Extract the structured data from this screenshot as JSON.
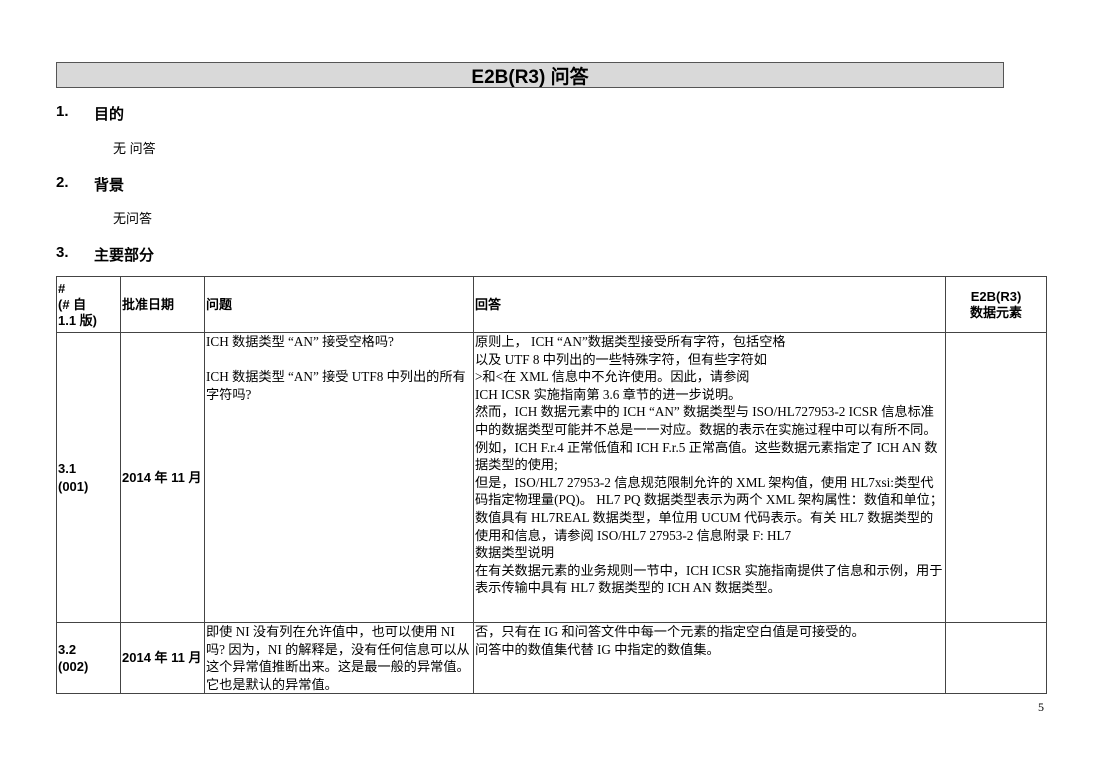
{
  "document": {
    "title": "E2B(R3) 问答",
    "page_number": "5"
  },
  "sections": [
    {
      "num": "1.",
      "title": "目的",
      "note": "无 问答"
    },
    {
      "num": "2.",
      "title": "背景",
      "note": "无问答"
    },
    {
      "num": "3.",
      "title": "主要部分"
    }
  ],
  "table": {
    "headers": {
      "id_line1": "#",
      "id_line2": "(# 自",
      "id_line3": "1.1 版)",
      "date": "批准日期",
      "question": "问题",
      "answer": "回答",
      "element_line1": "E2B(R3)",
      "element_line2": "数据元素"
    },
    "rows": [
      {
        "id_line1": "3.1",
        "id_line2": "(001)",
        "date": "2014 年 11 月",
        "question_p1": "ICH 数据类型 “AN” 接受空格吗?",
        "question_p2": "ICH 数据类型 “AN” 接受 UTF8 中列出的所有字符吗?",
        "answer_lines": [
          "原则上， ICH “AN”数据类型接受所有字符，包括空格",
          "以及 UTF 8 中列出的一些特殊字符，但有些字符如",
          ">和<在 XML 信息中不允许使用。因此，请参阅",
          "ICH ICSR 实施指南第 3.6 章节的进一步说明。",
          "然而，ICH 数据元素中的 ICH “AN” 数据类型与 ISO/HL727953-2 ICSR 信息标准中的数据类型可能并不总是一一对应。数据的表示在实施过程中可以有所不同。",
          "例如，ICH F.r.4 正常低值和 ICH F.r.5 正常高值。这些数据元素指定了 ICH AN 数据类型的使用;",
          "但是，ISO/HL7 27953-2 信息规范限制允许的 XML 架构值，使用 HL7xsi:类型代码指定物理量(PQ)。 HL7 PQ 数据类型表示为两个 XML 架构属性：数值和单位；数值具有 HL7REAL 数据类型，单位用 UCUM 代码表示。有关 HL7 数据类型的使用和信息，请参阅 ISO/HL7 27953-2 信息附录 F: HL7",
          "数据类型说明",
          "在有关数据元素的业务规则一节中，ICH ICSR 实施指南提供了信息和示例，用于表示传输中具有 HL7 数据类型的 ICH AN 数据类型。"
        ],
        "element": ""
      },
      {
        "id_line1": "3.2",
        "id_line2": "(002)",
        "date": "2014 年 11 月",
        "question_p1": "即使 NI 没有列在允许值中，也可以使用 NI 吗? 因为，NI 的解释是，没有任何信息可以从这个异常值推断出来。这是最一般的异常值。它也是默认的异常值。",
        "answer_lines": [
          "否，只有在 IG 和问答文件中每一个元素的指定空白值是可接受的。",
          "问答中的数值集代替 IG 中指定的数值集。"
        ],
        "element": ""
      }
    ]
  }
}
